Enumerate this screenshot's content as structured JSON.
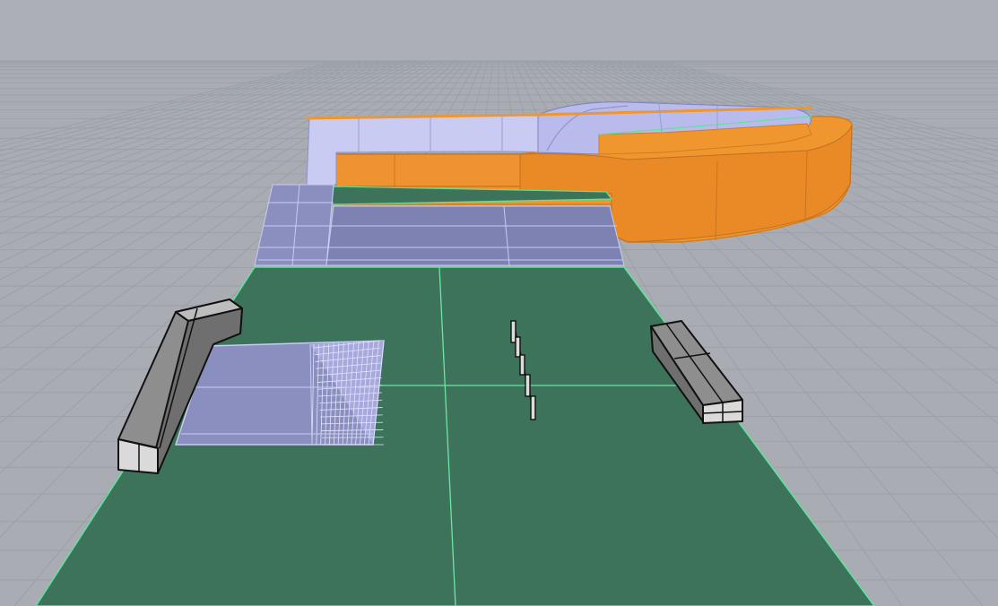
{
  "scene": {
    "kind": "3d-viewport-perspective",
    "objects": [
      "ground-grid",
      "green-base-plane",
      "quarter-pipe-ramp",
      "orange-bowl-wall",
      "bowl-interior",
      "funbox-wedge",
      "left-grind-box",
      "right-grind-box",
      "rail-posts"
    ]
  },
  "colors": {
    "background": "#a9adb3",
    "grid_line": "#9ca1a8",
    "ground": "#3c735a",
    "ground_edge": "#5fe39a",
    "ramp_fill": "#8a8fbf",
    "ramp_highlight": "#c9cbf2",
    "orange": "#f0962f",
    "orange_dark": "#d47c1f",
    "box_gray": "#8e8e8e",
    "box_light": "#dadada"
  }
}
